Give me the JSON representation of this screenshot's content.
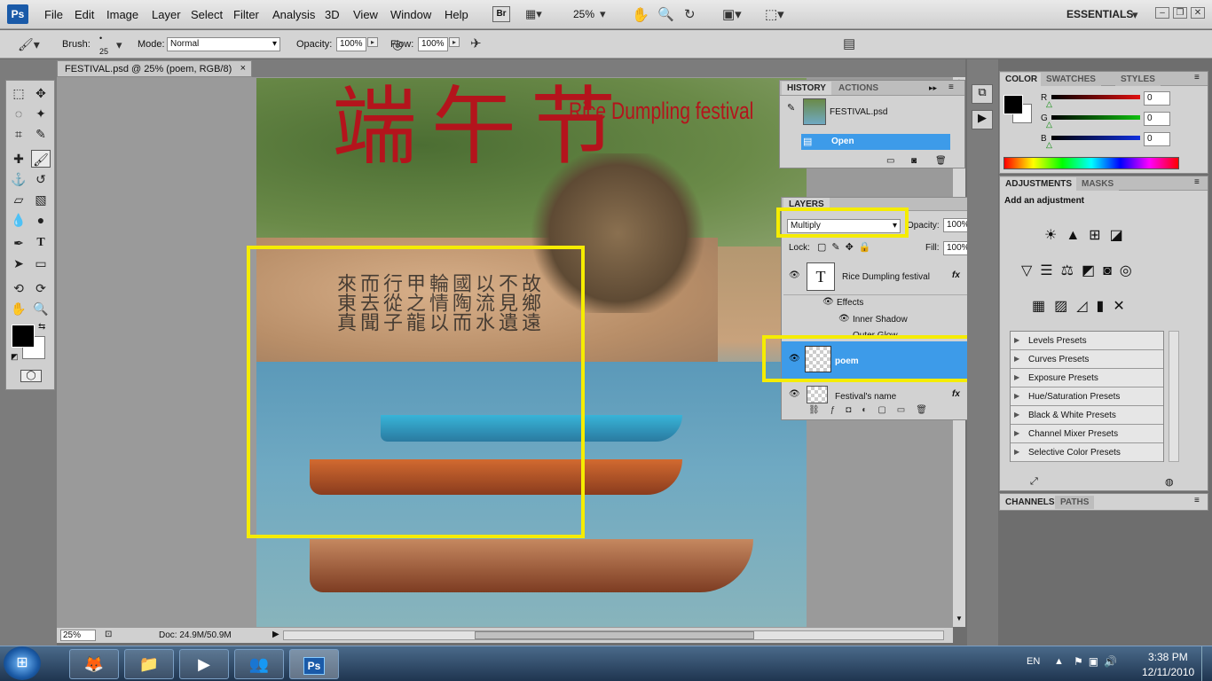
{
  "app": {
    "logo": "Ps",
    "menus": [
      "File",
      "Edit",
      "Image",
      "Layer",
      "Select",
      "Filter",
      "Analysis",
      "3D",
      "View",
      "Window",
      "Help"
    ],
    "toolbar": {
      "bridge": "Br",
      "zoom": "25%",
      "workspace": "ESSENTIALS"
    }
  },
  "options": {
    "brush_label": "Brush:",
    "brush_size": "25",
    "mode_label": "Mode:",
    "mode_value": "Normal",
    "opacity_label": "Opacity:",
    "opacity_value": "100%",
    "flow_label": "Flow:",
    "flow_value": "100%"
  },
  "document": {
    "tab_title": "FESTIVAL.psd @ 25% (poem, RGB/8)",
    "close": "×",
    "artwork": {
      "title_cn": "端午节",
      "title_en": "Rice Dumpling festival"
    }
  },
  "status": {
    "zoom": "25%",
    "doc": "Doc: 24.9M/50.9M"
  },
  "history": {
    "tabs": [
      "HISTORY",
      "ACTIONS"
    ],
    "snapshot": "FESTIVAL.psd",
    "items": [
      "Open"
    ]
  },
  "layers": {
    "tab": "LAYERS",
    "blend_mode": "Multiply",
    "opacity_label": "Opacity:",
    "opacity_value": "100%",
    "lock_label": "Lock:",
    "fill_label": "Fill:",
    "fill_value": "100%",
    "items": [
      {
        "name": "Rice Dumpling festival",
        "fx": "fx"
      },
      {
        "name": "Effects"
      },
      {
        "name": "Inner Shadow"
      },
      {
        "name": "Outer Glow"
      },
      {
        "name": "poem"
      },
      {
        "name": "Festival's name",
        "fx": "fx"
      }
    ]
  },
  "color": {
    "tabs": [
      "COLOR",
      "SWATCHES",
      "STYLES"
    ],
    "channels": [
      {
        "label": "R",
        "value": "0",
        "color": "#e01010"
      },
      {
        "label": "G",
        "value": "0",
        "color": "#10c010"
      },
      {
        "label": "B",
        "value": "0",
        "color": "#1030e0"
      }
    ]
  },
  "adjustments": {
    "tabs": [
      "ADJUSTMENTS",
      "MASKS"
    ],
    "heading": "Add an adjustment",
    "presets": [
      "Levels Presets",
      "Curves Presets",
      "Exposure Presets",
      "Hue/Saturation Presets",
      "Black & White Presets",
      "Channel Mixer Presets",
      "Selective Color Presets"
    ]
  },
  "channels": {
    "tabs": [
      "CHANNELS",
      "PATHS"
    ]
  },
  "taskbar": {
    "lang": "EN",
    "time": "3:38 PM",
    "date": "12/11/2010"
  }
}
